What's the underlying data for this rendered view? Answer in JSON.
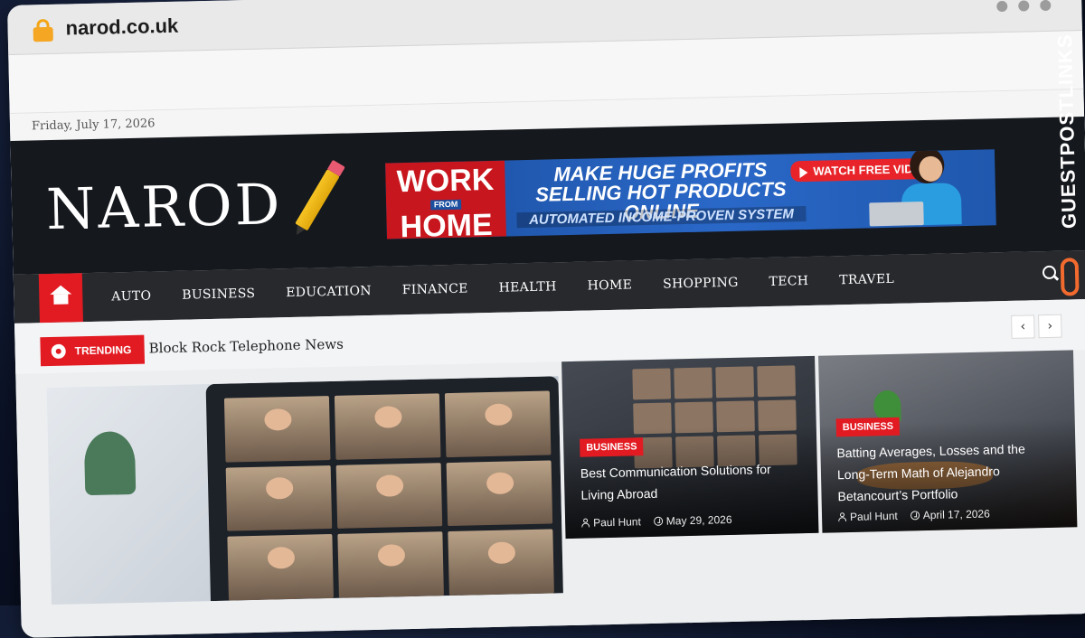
{
  "browser": {
    "url": "narod.co.uk"
  },
  "site": {
    "date": "Friday, July 17, 2026",
    "logo_text": "NAROD"
  },
  "ad_banner": {
    "work": "WORK",
    "from": "FROM",
    "home": "HOME",
    "headline": "MAKE HUGE PROFITS SELLING HOT PRODUCTS ONLINE",
    "subline": "AUTOMATED INCOME-PROVEN SYSTEM",
    "cta": "WATCH FREE VIDEO"
  },
  "nav": {
    "items": [
      "AUTO",
      "BUSINESS",
      "EDUCATION",
      "FINANCE",
      "HEALTH",
      "HOME",
      "SHOPPING",
      "TECH",
      "TRAVEL"
    ]
  },
  "trending": {
    "label": "TRENDING",
    "headline": "Block Rock Telephone News",
    "prev": "‹",
    "next": "›"
  },
  "cards": [
    {
      "category": "BUSINESS",
      "title": "Best Communication Solutions for Living Abroad",
      "author": "Paul Hunt",
      "date": "May 29, 2026"
    },
    {
      "category": "BUSINESS",
      "title": "Batting Averages, Losses and the Long-Term Math of Alejandro Betancourt’s Portfolio",
      "author": "Paul Hunt",
      "date": "April 17, 2026"
    }
  ],
  "watermark": {
    "text": "GUESTPOST",
    "links": "LINKS"
  },
  "colors": {
    "accent": "#e21b22",
    "nav_bg": "#27292d",
    "masthead_bg": "#15181d"
  }
}
